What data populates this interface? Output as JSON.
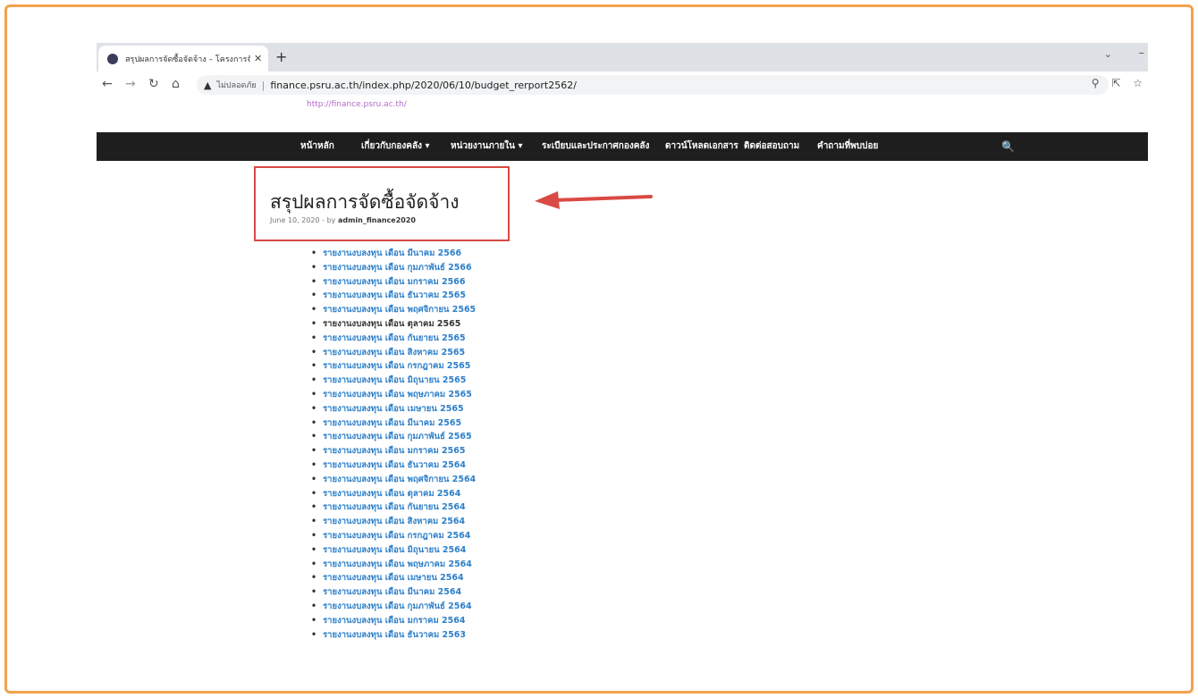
{
  "browser": {
    "tab": {
      "title": "สรุปผลการจัดซื้อจัดจ้าง – โครงการจัด",
      "close_glyph": "✕"
    },
    "newtab_glyph": "+",
    "window": {
      "chevron_glyph": "⌄",
      "minimize_glyph": "–"
    },
    "nav": {
      "back": "←",
      "forward": "→",
      "reload": "↻",
      "home": "⌂"
    },
    "omnibox": {
      "warning_glyph": "▲",
      "insecure_label": "ไม่ปลอดภัย",
      "url": "finance.psru.ac.th/index.php/2020/06/10/budget_rerport2562/"
    },
    "right_icons": {
      "zoom": "⚲",
      "share": "⇱",
      "bookmark": "☆"
    }
  },
  "site": {
    "link_text": "http://finance.psru.ac.th/",
    "nav_items": [
      {
        "label": "หน้าหลัก"
      },
      {
        "label": "เกี่ยวกับกองคลัง ▾"
      },
      {
        "label": "หน่วยงานภายใน ▾"
      },
      {
        "label": "ระเบียบและประกาศกองคลัง"
      },
      {
        "label": "ดาวน์โหลดเอกสาร"
      },
      {
        "label": "ติดต่อสอบถาม"
      },
      {
        "label": "คำถามที่พบบ่อย"
      }
    ],
    "search_glyph": "🔍"
  },
  "post": {
    "title": "สรุปผลการจัดซื้อจัดจ้าง",
    "date": "June 10, 2020",
    "by": "- by",
    "author": "admin_finance2020"
  },
  "colors": {
    "annotation_red": "#d94a44",
    "link_blue": "#2d7fc9",
    "navbar_bg": "#1e1e1e",
    "frame_orange": "#f3a24e"
  },
  "reports": [
    "รายงานงบลงทุน เดือน มีนาคม 2566",
    "รายงานงบลงทุน เดือน กุมภาพันธ์ 2566",
    "รายงานงบลงทุน เดือน มกราคม 2566",
    "รายงานงบลงทุน เดือน ธันวาคม 2565",
    "รายงานงบลงทุน เดือน พฤศจิกายน 2565",
    "รายงานงบลงทุน เดือน ตุลาคม 2565",
    "รายงานงบลงทุน เดือน กันยายน 2565",
    "รายงานงบลงทุน เดือน สิงหาคม 2565",
    "รายงานงบลงทุน เดือน กรกฎาคม 2565",
    "รายงานงบลงทุน เดือน มิถุนายน 2565",
    "รายงานงบลงทุน เดือน พฤษภาคม 2565",
    "รายงานงบลงทุน เดือน เมษายน 2565",
    "รายงานงบลงทุน เดือน มีนาคม 2565",
    "รายงานงบลงทุน เดือน กุมภาพันธ์ 2565",
    "รายงานงบลงทุน เดือน มกราคม 2565",
    "รายงานงบลงทุน เดือน ธันวาคม 2564",
    "รายงานงบลงทุน เดือน พฤศจิกายน 2564",
    "รายงานงบลงทุน เดือน ตุลาคม 2564",
    "รายงานงบลงทุน เดือน กันยายน 2564",
    "รายงานงบลงทุน เดือน สิงหาคม 2564",
    "รายงานงบลงทุน เดือน กรกฎาคม 2564",
    "รายงานงบลงทุน เดือน มิถุนายน 2564",
    "รายงานงบลงทุน เดือน พฤษภาคม 2564",
    "รายงานงบลงทุน เดือน เมษายน 2564",
    "รายงานงบลงทุน เดือน มีนาคม 2564",
    "รายงานงบลงทุน เดือน กุมภาพันธ์ 2564",
    "รายงานงบลงทุน เดือน มกราคม 2564",
    "รายงานงบลงทุน เดือน ธันวาคม 2563"
  ]
}
